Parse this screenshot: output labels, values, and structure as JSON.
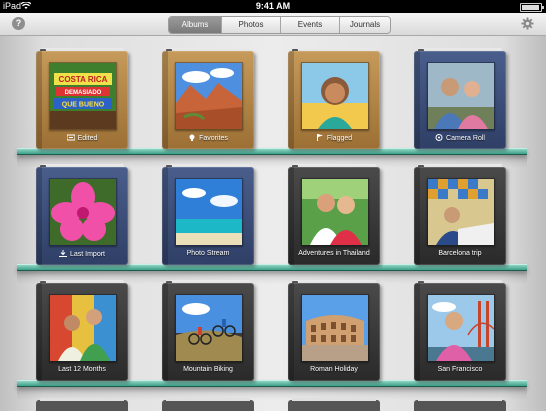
{
  "status_bar": {
    "carrier": "iPad",
    "time": "9:41 AM"
  },
  "toolbar": {
    "help_label": "?",
    "tabs": [
      {
        "label": "Albums",
        "active": true
      },
      {
        "label": "Photos",
        "active": false
      },
      {
        "label": "Events",
        "active": false
      },
      {
        "label": "Journals",
        "active": false
      }
    ]
  },
  "albums": [
    {
      "title": "Edited",
      "style": "leather",
      "icon": "edit-icon"
    },
    {
      "title": "Favorites",
      "style": "leather",
      "icon": "favorite-icon"
    },
    {
      "title": "Flagged",
      "style": "leather",
      "icon": "flag-icon"
    },
    {
      "title": "Camera Roll",
      "style": "blue",
      "icon": "camera-roll-icon"
    },
    {
      "title": "Last Import",
      "style": "blue",
      "icon": "import-icon"
    },
    {
      "title": "Photo Stream",
      "style": "blue",
      "icon": null
    },
    {
      "title": "Adventures in Thailand",
      "style": "black",
      "icon": null
    },
    {
      "title": "Barcelona trip",
      "style": "black",
      "icon": null
    },
    {
      "title": "Last 12 Months",
      "style": "black",
      "icon": null
    },
    {
      "title": "Mountain Biking",
      "style": "black",
      "icon": null
    },
    {
      "title": "Roman Holiday",
      "style": "black",
      "icon": null
    },
    {
      "title": "San Francisco",
      "style": "black",
      "icon": null
    }
  ],
  "colors": {
    "shelf_glass": "#3d9e87",
    "active_tab": "#8a8a8a"
  },
  "photo_text": [
    "COSTA RICA",
    "DEMASIADO",
    "QUE BUENO"
  ]
}
